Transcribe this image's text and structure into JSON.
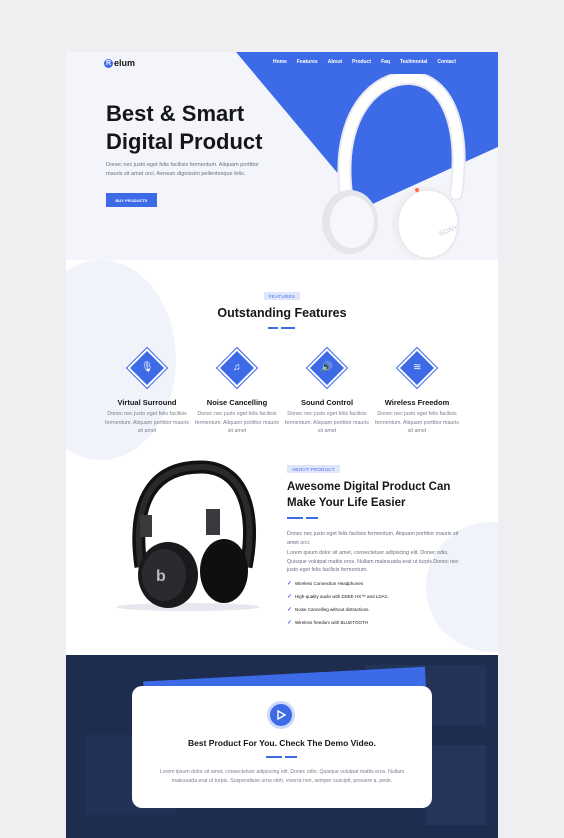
{
  "nav": {
    "logo_mark": "R",
    "logo_text": "elum",
    "items": [
      "Home",
      "Features",
      "About",
      "Product",
      "Faq",
      "Testimonial",
      "Contact"
    ]
  },
  "hero": {
    "title": "Best & Smart Digital Product",
    "text": "Donec nec justo eget felis facilisis fermentum. Aliquam porttitor mauris sit amet orci. Aenean dignissim pellentesque felis.",
    "button": "BUY PRODUCTS",
    "device_brand": "SONY"
  },
  "features": {
    "tag": "FEATURES",
    "title": "Outstanding Features",
    "items": [
      {
        "icon": "microphone-icon",
        "glyph": "🎙",
        "title": "Virtual Surround",
        "text": "Donec nec justo eget felis facilisis fermentum. Aliquam porttitor mauris sit amet"
      },
      {
        "icon": "music-note-icon",
        "glyph": "♫",
        "title": "Noise Cancelling",
        "text": "Donec nec justo eget felis facilisis fermentum. Aliquam porttitor mauris sit amet"
      },
      {
        "icon": "speaker-icon",
        "glyph": "🔊",
        "title": "Sound Control",
        "text": "Donec nec justo eget felis facilisis fermentum. Aliquam porttitor mauris sit amet"
      },
      {
        "icon": "wifi-icon",
        "glyph": "≋",
        "title": "Wireless Freedom",
        "text": "Donec nec justo eget felis facilisis fermentum. Aliquam porttitor mauris sit amet"
      }
    ]
  },
  "about": {
    "tag": "ABOUT PRODUCT",
    "title": "Awesome Digital Product Can Make Your Life Easier",
    "paragraph1": "Donec nec justo eget felis facilisis fermentum. Aliquam porttitor mauris sit amet orci.",
    "paragraph2": "Lorem ipsum dolor sit amet, consectetuer adipiscing elit. Donec odio. Quisque volutpat mattis eros. Nullam malesuada erat ut turpis.Donec nec justo eget felis facilisis fermentum.",
    "bullets": [
      "Wireless Connection Headphones",
      "High-quality audio with DSEE HX™ and LDAC.",
      "Noise Cancelling without distractions.",
      "Wireless freedom with BLUETOOTH"
    ]
  },
  "video": {
    "title": "Best Product For You. Check The Demo Video.",
    "text": "Lorem ipsum dolor sit amet, consectetuer adipiscing elit. Donec odio. Quisque volutpat mattis eros. Nullam malesuada erat ut turpis. Suspendisse urna nibh, viverra non, semper suscipit, posuere a, pede."
  },
  "colors": {
    "accent": "#3d6be8",
    "dark": "#1e2c4f",
    "text": "#14161b",
    "muted": "#7b8090"
  }
}
